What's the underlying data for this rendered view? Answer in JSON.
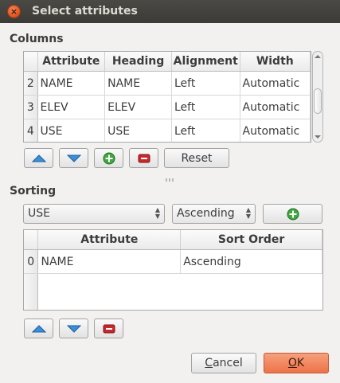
{
  "window": {
    "title": "Select attributes"
  },
  "columns_section": {
    "label": "Columns",
    "headers": [
      "",
      "Attribute",
      "Heading",
      "Alignment",
      "Width"
    ],
    "rows": [
      {
        "num": "2",
        "attribute": "NAME",
        "heading": "NAME",
        "alignment": "Left",
        "width": "Automatic"
      },
      {
        "num": "3",
        "attribute": "ELEV",
        "heading": "ELEV",
        "alignment": "Left",
        "width": "Automatic"
      },
      {
        "num": "4",
        "attribute": "USE",
        "heading": "USE",
        "alignment": "Left",
        "width": "Automatic"
      }
    ],
    "reset_label": "Reset"
  },
  "sorting_section": {
    "label": "Sorting",
    "attribute_combo": "USE",
    "order_combo": "Ascending",
    "headers": [
      "",
      "Attribute",
      "Sort Order"
    ],
    "rows": [
      {
        "num": "0",
        "attribute": "NAME",
        "order": "Ascending"
      }
    ]
  },
  "buttons": {
    "cancel_pre": "",
    "cancel_u": "C",
    "cancel_rest": "ancel",
    "ok_u": "O",
    "ok_rest": "K"
  },
  "colors": {
    "accent": "#ed7347",
    "up_icon": "#3a8fd8",
    "add_icon": "#3fa83f",
    "remove_icon": "#c8282d"
  }
}
